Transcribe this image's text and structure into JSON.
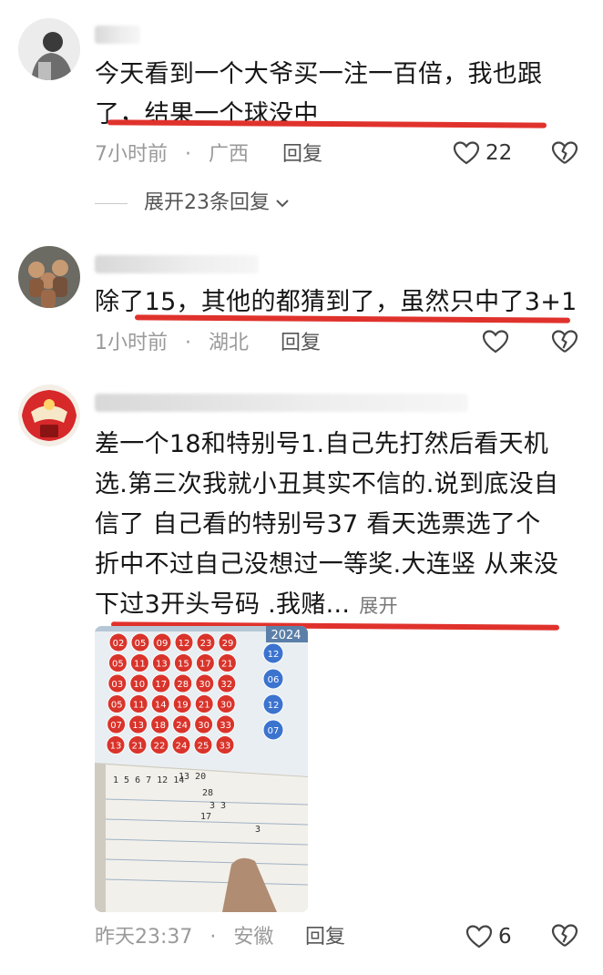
{
  "comments": [
    {
      "text": "今天看到一个大爷买一注一百倍，我也跟了，结果一个球没中",
      "line1": "今天看到一个大爷买一注一百倍，我也跟",
      "line2": "了，结果一个球没中",
      "time": "7小时前",
      "location": "广西",
      "reply_label": "回复",
      "likes": "22",
      "expand_label": "展开23条回复"
    },
    {
      "text": "除了15，其他的都猜到了，虽然只中了3+1",
      "time": "1小时前",
      "location": "湖北",
      "reply_label": "回复"
    },
    {
      "line1": "差一个18和特别号1.自己先打然后看天机",
      "line2": "选.第三次我就小丑其实不信的.说到底没自",
      "line3": "信了  自己看的特别号37  看天选票选了个",
      "line4": "折中不过自己没想过一等奖.大连竖  从来没",
      "line5": "下过3开头号码 .我赌...",
      "more_label": "展开",
      "time": "昨天23:37",
      "location": "安徽",
      "reply_label": "回复",
      "likes": "6"
    }
  ],
  "separator_dot": "·",
  "photo": {
    "year_text": "2024",
    "rows": [
      [
        "02",
        "05",
        "09",
        "12",
        "23",
        "29"
      ],
      [
        "05",
        "11",
        "13",
        "15",
        "17",
        "21"
      ],
      [
        "03",
        "10",
        "17",
        "28",
        "30",
        "32"
      ],
      [
        "05",
        "11",
        "14",
        "19",
        "21",
        "30"
      ],
      [
        "07",
        "13",
        "18",
        "24",
        "30",
        "33"
      ],
      [
        "13",
        "21",
        "22",
        "24",
        "25",
        "33"
      ]
    ],
    "blue_balls": [
      "12",
      "06",
      "12",
      "07"
    ],
    "handwriting": [
      "1 5 6 7  12  14",
      "13   20",
      "28",
      "3 3",
      "17",
      "3"
    ]
  },
  "colors": {
    "underline": "#e0322c",
    "meta": "#9a9a9a"
  }
}
